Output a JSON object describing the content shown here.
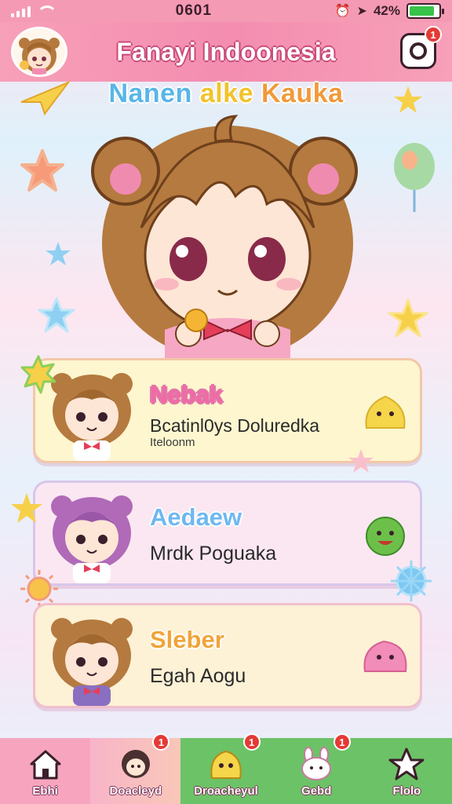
{
  "status_bar": {
    "time": "0601",
    "battery_text": "42%",
    "battery_level": 0.85
  },
  "header": {
    "title": "Fanayi Indoonesia",
    "notification_badge": "1"
  },
  "subtitle": {
    "part1": "Nanen",
    "part2": "alke",
    "part3": "Kauka"
  },
  "cards": [
    {
      "title": "Nebak",
      "desc": "Bcatinl0ys Doluredka",
      "desc2": "Iteloonm"
    },
    {
      "title": "Aedaew",
      "desc": "Mrdk Poguaka"
    },
    {
      "title": "Sleber",
      "desc": "Egah Aogu"
    }
  ],
  "nav": [
    {
      "label": "Ebhi",
      "icon": "home-icon",
      "badge": ""
    },
    {
      "label": "Doacleyd",
      "icon": "girl-avatar-icon",
      "badge": "1"
    },
    {
      "label": "Droacheyul",
      "icon": "yellow-blob-icon",
      "badge": "1"
    },
    {
      "label": "Gebd",
      "icon": "bunny-icon",
      "badge": "1"
    },
    {
      "label": "Flolo",
      "icon": "star-icon",
      "badge": ""
    }
  ],
  "colors": {
    "header": "#f48db0",
    "nav_green": "#6cc266",
    "badge": "#e53935"
  }
}
